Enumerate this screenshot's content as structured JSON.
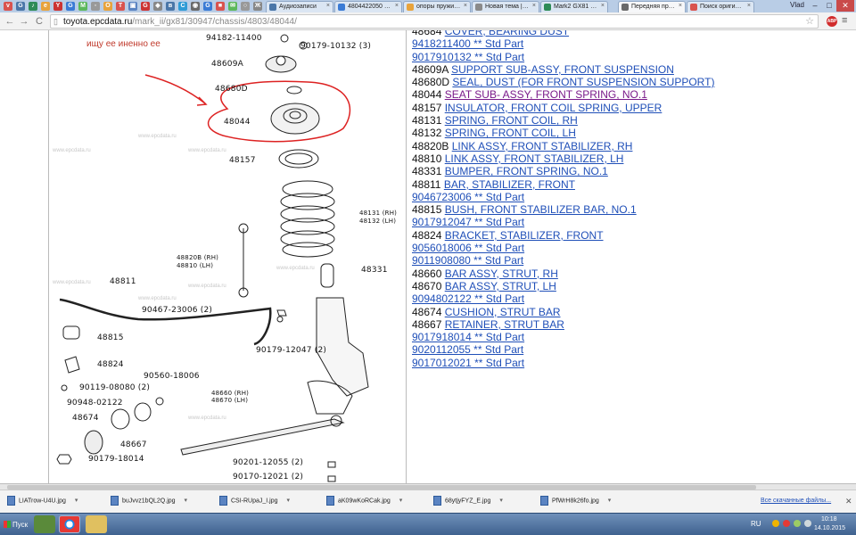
{
  "tabs": [
    {
      "label": "",
      "color": "#d9534f",
      "active": false
    },
    {
      "label": "Аудиозаписи",
      "color": "#4a76a8",
      "active": false
    },
    {
      "label": "4804422050 — 3",
      "color": "#3a7bd5",
      "active": false
    },
    {
      "label": "опоры пружин на",
      "color": "#e8a33c",
      "active": false
    },
    {
      "label": "Новая тема | 32X",
      "color": "#8a8a8a",
      "active": false
    },
    {
      "label": "Mark2 GX81 Оперр",
      "color": "#2e8b57",
      "active": false
    },
    {
      "label": "Передняя пружин",
      "color": "#6a6a6a",
      "active": true
    },
    {
      "label": "Поиск оригинальн",
      "color": "#d9534f",
      "active": false
    }
  ],
  "window": {
    "user": "Vlad",
    "minimize": "–",
    "maximize": "□",
    "close": "✕"
  },
  "nav": {
    "back": "←",
    "forward": "→",
    "reload": "C"
  },
  "address": {
    "host": "toyota.epcdata.ru",
    "path": "/mark_ii/gx81/30947/chassis/4803/48044/"
  },
  "extensions": {
    "adblock": "ABP"
  },
  "diagram": {
    "note": "ищу ее иненно ее",
    "watermark": "www.epcdata.ru",
    "labels": [
      {
        "key": "p94182",
        "text": "94182-11400"
      },
      {
        "key": "p90179a",
        "text": "90179-10132 (3)"
      },
      {
        "key": "p48609a",
        "text": "48609A"
      },
      {
        "key": "p48680d",
        "text": "48680D"
      },
      {
        "key": "p48044",
        "text": "48044"
      },
      {
        "key": "p48157",
        "text": "48157"
      },
      {
        "key": "p48131",
        "text": "48131 (RH)"
      },
      {
        "key": "p48132",
        "text": "48132 (LH)"
      },
      {
        "key": "p48820b",
        "text": "48820B (RH)"
      },
      {
        "key": "p48810",
        "text": "48810 (LH)"
      },
      {
        "key": "p48331",
        "text": "48331"
      },
      {
        "key": "p48811",
        "text": "48811"
      },
      {
        "key": "p90467",
        "text": "90467-23006 (2)"
      },
      {
        "key": "p48815",
        "text": "48815"
      },
      {
        "key": "p90179b",
        "text": "90179-12047 (2)"
      },
      {
        "key": "p48824",
        "text": "48824"
      },
      {
        "key": "p90560",
        "text": "90560-18006"
      },
      {
        "key": "p90119",
        "text": "90119-08080 (2)"
      },
      {
        "key": "p90948",
        "text": "90948-02122"
      },
      {
        "key": "p48660",
        "text": "48660 (RH)"
      },
      {
        "key": "p48670",
        "text": "48670 (LH)"
      },
      {
        "key": "p48674",
        "text": "48674"
      },
      {
        "key": "p48667",
        "text": "48667"
      },
      {
        "key": "p90179c",
        "text": "90179-18014"
      },
      {
        "key": "p90201",
        "text": "90201-12055 (2)"
      },
      {
        "key": "p90170",
        "text": "90170-12021 (2)"
      }
    ]
  },
  "parts": [
    {
      "num": "48684",
      "desc": "COVER, BEARING DUST",
      "link_only": false,
      "visited": false
    },
    {
      "num": "",
      "desc": "9418211400 ** Std Part",
      "link_only": true,
      "visited": false
    },
    {
      "num": "",
      "desc": "9017910132 ** Std Part",
      "link_only": true,
      "visited": false
    },
    {
      "num": "48609A",
      "desc": "SUPPORT SUB-ASSY, FRONT SUSPENSION",
      "link_only": false,
      "visited": false
    },
    {
      "num": "48680D",
      "desc": "SEAL, DUST (FOR FRONT SUSPENSION SUPPORT)",
      "link_only": false,
      "visited": false
    },
    {
      "num": "48044",
      "desc": "SEAT SUB- ASSY, FRONT SPRING, NO.1",
      "link_only": false,
      "visited": true
    },
    {
      "num": "48157",
      "desc": "INSULATOR, FRONT COIL SPRING, UPPER",
      "link_only": false,
      "visited": false
    },
    {
      "num": "48131",
      "desc": "SPRING, FRONT COIL, RH",
      "link_only": false,
      "visited": false
    },
    {
      "num": "48132",
      "desc": "SPRING, FRONT COIL, LH",
      "link_only": false,
      "visited": false
    },
    {
      "num": "48820B",
      "desc": "LINK ASSY, FRONT STABILIZER, RH",
      "link_only": false,
      "visited": false
    },
    {
      "num": "48810",
      "desc": "LINK ASSY, FRONT STABILIZER, LH",
      "link_only": false,
      "visited": false
    },
    {
      "num": "48331",
      "desc": "BUMPER, FRONT SPRING, NO.1",
      "link_only": false,
      "visited": false
    },
    {
      "num": "48811",
      "desc": "BAR, STABILIZER, FRONT",
      "link_only": false,
      "visited": false
    },
    {
      "num": "",
      "desc": "9046723006 ** Std Part",
      "link_only": true,
      "visited": false
    },
    {
      "num": "48815",
      "desc": "BUSH, FRONT STABILIZER BAR, NO.1",
      "link_only": false,
      "visited": false
    },
    {
      "num": "",
      "desc": "9017912047 ** Std Part",
      "link_only": true,
      "visited": false
    },
    {
      "num": "48824",
      "desc": "BRACKET, STABILIZER, FRONT",
      "link_only": false,
      "visited": false
    },
    {
      "num": "",
      "desc": "9056018006 ** Std Part",
      "link_only": true,
      "visited": false
    },
    {
      "num": "",
      "desc": "9011908080 ** Std Part",
      "link_only": true,
      "visited": false
    },
    {
      "num": "48660",
      "desc": "BAR ASSY, STRUT, RH",
      "link_only": false,
      "visited": false
    },
    {
      "num": "48670",
      "desc": "BAR ASSY, STRUT, LH",
      "link_only": false,
      "visited": false
    },
    {
      "num": "",
      "desc": "9094802122 ** Std Part",
      "link_only": true,
      "visited": false
    },
    {
      "num": "48674",
      "desc": "CUSHION, STRUT BAR",
      "link_only": false,
      "visited": false
    },
    {
      "num": "48667",
      "desc": "RETAINER, STRUT BAR",
      "link_only": false,
      "visited": false
    },
    {
      "num": "",
      "desc": "9017918014 ** Std Part",
      "link_only": true,
      "visited": false
    },
    {
      "num": "",
      "desc": "9020112055 ** Std Part",
      "link_only": true,
      "visited": false
    },
    {
      "num": "",
      "desc": "9017012021 ** Std Part",
      "link_only": true,
      "visited": false
    }
  ],
  "downloads": {
    "items": [
      "LIATrow-U4U.jpg",
      "buJvvz1bQL2Q.jpg",
      "CSI-RUpaJ_I.jpg",
      "aK09wKoRCak.jpg",
      "68ytjyFYZ_E.jpg",
      "PfWrH8k26fo.jpg"
    ],
    "show_all": "Все скачанные файлы...",
    "close": "✕"
  },
  "taskbar": {
    "start": "Пуск",
    "lang": "RU",
    "time": "10:18",
    "date": "14.10.2015"
  }
}
